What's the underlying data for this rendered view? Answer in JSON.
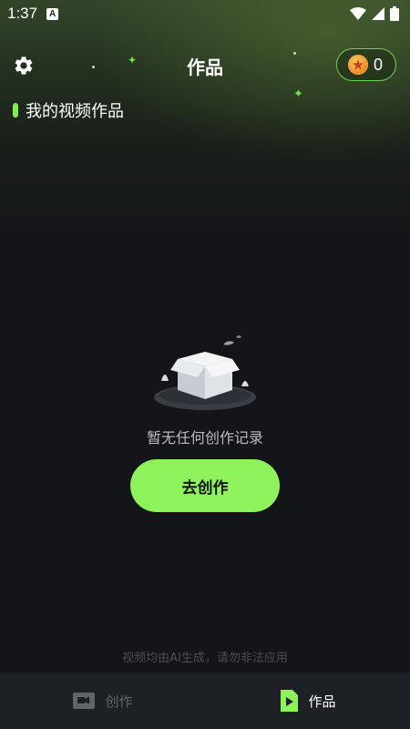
{
  "status_bar": {
    "time": "1:37",
    "notification_icon": "a-badge-icon",
    "icons": [
      "wifi-icon",
      "cell-signal-icon",
      "battery-icon"
    ]
  },
  "header": {
    "title": "作品",
    "settings_icon": "gear-icon",
    "coin_icon": "coin-icon",
    "coin_count": "0"
  },
  "section": {
    "title": "我的视频作品"
  },
  "empty_state": {
    "illustration": "empty-box-icon",
    "message": "暂无任何创作记录",
    "button_label": "去创作"
  },
  "footer": {
    "disclaimer": "视频均由AI生成，请勿非法应用"
  },
  "bottom_nav": {
    "items": [
      {
        "label": "创作",
        "icon": "video-camera-icon",
        "active": false
      },
      {
        "label": "作品",
        "icon": "play-file-icon",
        "active": true
      }
    ]
  },
  "colors": {
    "accent": "#8ef25b",
    "background": "#141519",
    "nav_background": "#1d2025",
    "coin_border": "#6cd44a"
  }
}
